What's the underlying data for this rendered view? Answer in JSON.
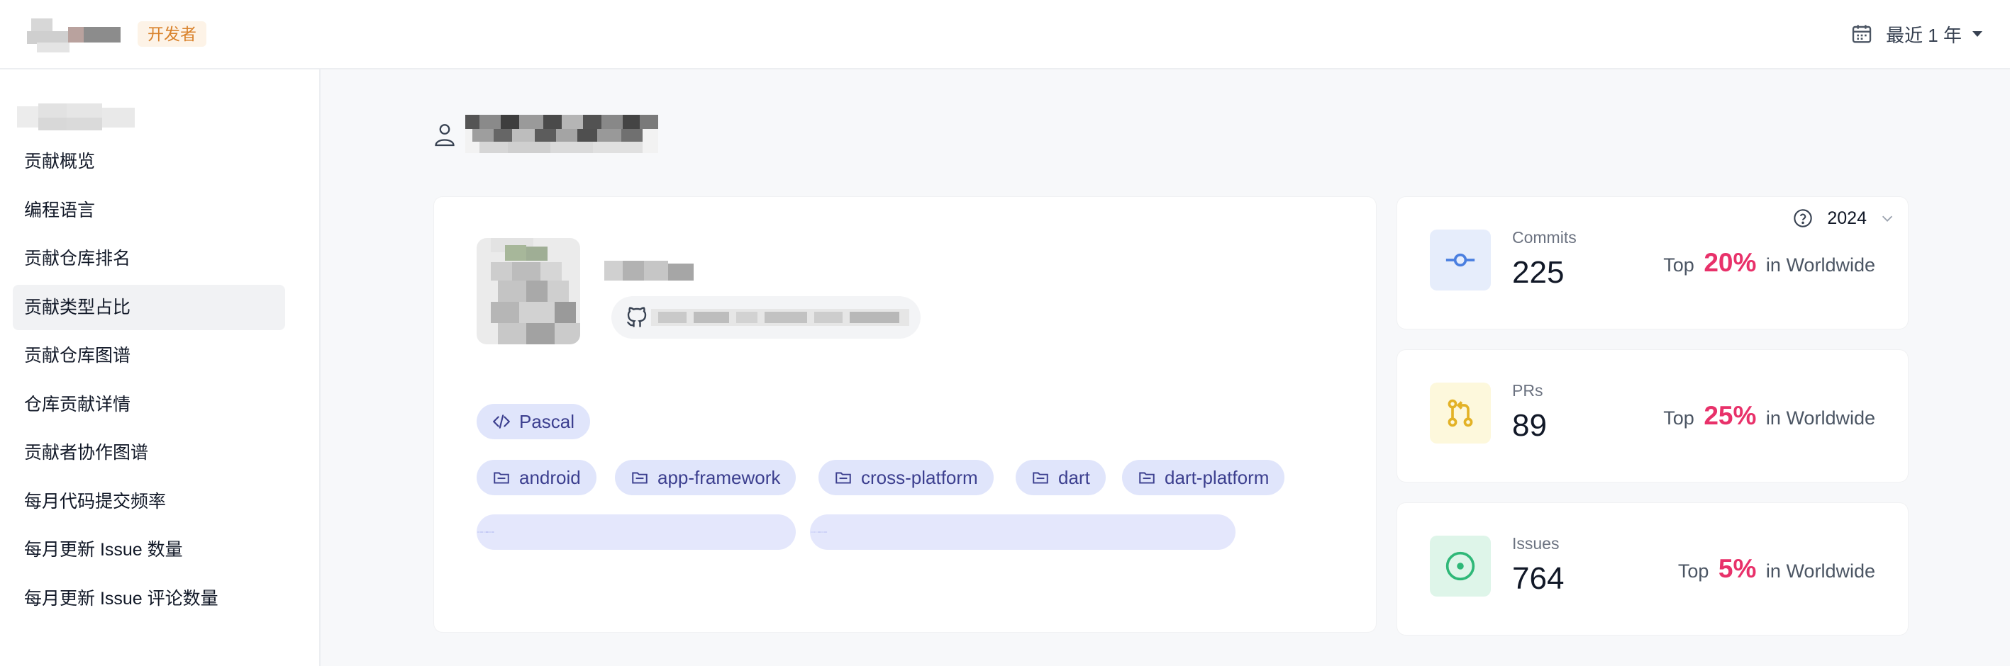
{
  "header": {
    "badge": "开发者",
    "range_label": "最近 1 年",
    "icons": {
      "calendar": "calendar-icon",
      "caret": "chevron-down-icon"
    }
  },
  "sidebar": {
    "items": [
      {
        "label": "贡献概览",
        "active": false
      },
      {
        "label": "编程语言",
        "active": false
      },
      {
        "label": "贡献仓库排名",
        "active": false
      },
      {
        "label": "贡献类型占比",
        "active": true
      },
      {
        "label": "贡献仓库图谱",
        "active": false
      },
      {
        "label": "仓库贡献详情",
        "active": false
      },
      {
        "label": "贡献者协作图谱",
        "active": false
      },
      {
        "label": "每月代码提交频率",
        "active": false
      },
      {
        "label": "每月更新 Issue 数量",
        "active": false
      },
      {
        "label": "每月更新 Issue 评论数量",
        "active": false
      }
    ]
  },
  "profile": {
    "language": "Pascal",
    "topics": [
      "android",
      "app-framework",
      "cross-platform",
      "dart",
      "dart-platform"
    ]
  },
  "stats": {
    "year": "2024",
    "items": [
      {
        "label": "Commits",
        "value": "225",
        "prefix": "Top",
        "percent": "20%",
        "suffix": "in Worldwide",
        "icon": "commit-icon",
        "bg": "#e6edfb",
        "fg": "#4a7fe0"
      },
      {
        "label": "PRs",
        "value": "89",
        "prefix": "Top",
        "percent": "25%",
        "suffix": "in Worldwide",
        "icon": "pull-request-icon",
        "bg": "#fdf8dc",
        "fg": "#e3b226"
      },
      {
        "label": "Issues",
        "value": "764",
        "prefix": "Top",
        "percent": "5%",
        "suffix": "in Worldwide",
        "icon": "issue-icon",
        "bg": "#def5e9",
        "fg": "#2fb878"
      }
    ]
  },
  "colors": {
    "accent_percent": "#e8316a",
    "chip_bg": "#e0e5fb",
    "chip_text": "#3c3f8f",
    "badge_text": "#d9822b"
  }
}
